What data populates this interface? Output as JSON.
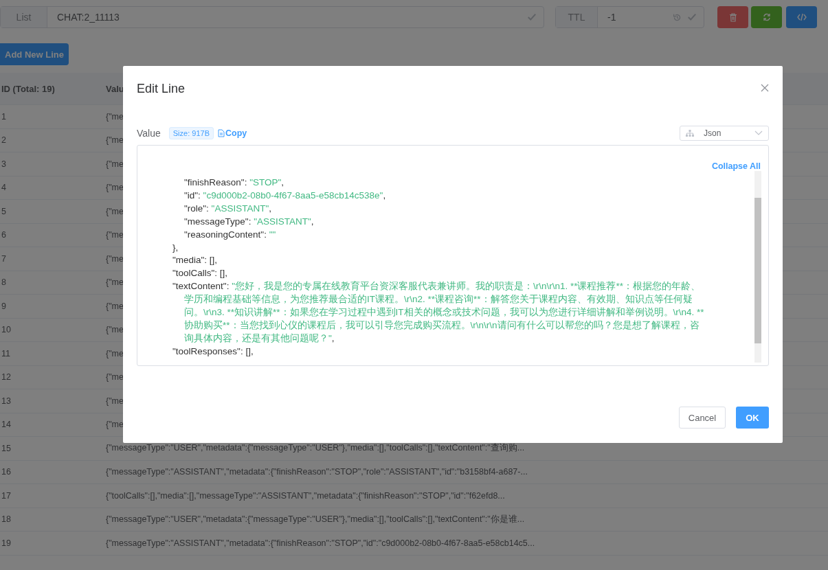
{
  "toolbar": {
    "key_type": "List",
    "key_name": "CHAT:2_11113",
    "ttl_label": "TTL",
    "ttl_value": "-1"
  },
  "add_button": "Add New Line",
  "table": {
    "columns": [
      "ID (Total: 19)",
      "Valu"
    ],
    "rows": [
      {
        "id": "1",
        "value": "{\"me"
      },
      {
        "id": "2",
        "value": "{\"me"
      },
      {
        "id": "3",
        "value": "{\"me"
      },
      {
        "id": "4",
        "value": "{\"me"
      },
      {
        "id": "5",
        "value": "{\"me"
      },
      {
        "id": "6",
        "value": "{\"me"
      },
      {
        "id": "7",
        "value": "{\"me"
      },
      {
        "id": "8",
        "value": "{\"me"
      },
      {
        "id": "9",
        "value": "{\"me"
      },
      {
        "id": "10",
        "value": "{\"me"
      },
      {
        "id": "11",
        "value": "{\"me"
      },
      {
        "id": "12",
        "value": "{\"me"
      },
      {
        "id": "13",
        "value": "{\"me"
      },
      {
        "id": "14",
        "value": "{\"me"
      },
      {
        "id": "15",
        "value": "{\"messageType\":\"USER\",\"metadata\":{\"messageType\":\"USER\"},\"media\":[],\"toolCalls\":[],\"textContent\":\"查询购..."
      },
      {
        "id": "16",
        "value": "{\"messageType\":\"ASSISTANT\",\"metadata\":{\"finishReason\":\"STOP\",\"role\":\"ASSISTANT\",\"id\":\"b3158bf4-a687-..."
      },
      {
        "id": "17",
        "value": "{\"toolCalls\":[],\"media\":[],\"messageType\":\"ASSISTANT\",\"metadata\":{\"finishReason\":\"STOP\",\"id\":\"f62efd8..."
      },
      {
        "id": "18",
        "value": "{\"messageType\":\"USER\",\"metadata\":{\"messageType\":\"USER\"},\"media\":[],\"toolCalls\":[],\"textContent\":\"你是谁..."
      },
      {
        "id": "19",
        "value": "{\"messageType\":\"ASSISTANT\",\"metadata\":{\"finishReason\":\"STOP\",\"id\":\"c9d000b2-08b0-4f67-8aa5-e58cb14c5..."
      }
    ]
  },
  "dialog": {
    "title": "Edit Line",
    "value_label": "Value",
    "size_tag": "Size: 917B",
    "copy_link": "Copy",
    "format_select": "Json",
    "collapse_link": "Collapse All",
    "lines": [
      {
        "kind": "group",
        "children": [
          {
            "kind": "pair",
            "key": "\"finishReason\":",
            "value": "\"STOP\"",
            "rest": ","
          },
          {
            "kind": "pair",
            "key": "\"id\":",
            "value": "\"c9d000b2-08b0-4f67-8aa5-e58cb14c538e\"",
            "rest": ","
          },
          {
            "kind": "pair",
            "key": "\"role\":",
            "value": "\"ASSISTANT\"",
            "rest": ","
          },
          {
            "kind": "pair",
            "key": "\"messageType\":",
            "value": "\"ASSISTANT\"",
            "rest": ","
          },
          {
            "kind": "pair",
            "key": "\"reasoningContent\":",
            "value": "\"\""
          }
        ]
      },
      {
        "kind": "plain",
        "text": "},"
      },
      {
        "kind": "plain",
        "text": "\"media\": [],"
      },
      {
        "kind": "plain",
        "text": "\"toolCalls\": [],"
      },
      {
        "kind": "pair",
        "key": "\"textContent\":",
        "value": "\"您好，我是您的专属在线教育平台资深客服代表兼讲师。我的职责是：\\r\\n\\r\\n1. **课程推荐**：根据您的年龄、学历和编程基础等信息，为您推荐最合适的IT课程。\\r\\n2. **课程咨询**：解答您关于课程内容、有效期、知识点等任何疑问。\\r\\n3. **知识讲解**：如果您在学习过程中遇到IT相关的概念或技术问题，我可以为您进行详细讲解和举例说明。\\r\\n4. **协助购买**：当您找到心仪的课程后，我可以引导您完成购买流程。\\r\\n\\r\\n请问有什么可以帮您的吗？您是想了解课程，咨询具体内容，还是有其他问题呢？\"",
        "rest": ","
      },
      {
        "kind": "plain",
        "text": "\"toolResponses\": [],"
      }
    ],
    "cancel_button": "Cancel",
    "ok_button": "OK"
  }
}
